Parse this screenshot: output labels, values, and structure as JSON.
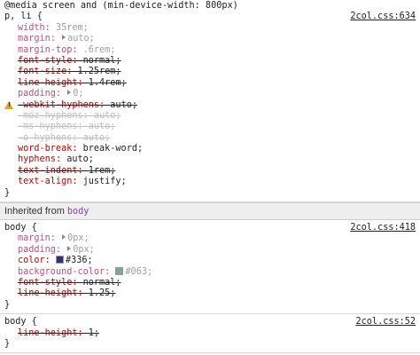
{
  "rules": [
    {
      "lines": [
        {
          "kind": "text",
          "text": "@media screen and (min-device-width: 800px)"
        },
        {
          "kind": "selector",
          "text": "p, li {",
          "source": "2col.css:634"
        }
      ],
      "decls": [
        {
          "prop": "width",
          "value": "35rem;",
          "style": "prop-b"
        },
        {
          "prop": "margin",
          "value": "auto;",
          "style": "prop-b",
          "arrow": true
        },
        {
          "prop": "margin-top",
          "value": ".6rem;",
          "style": "prop-b"
        },
        {
          "prop": "font-style",
          "value": "normal;",
          "style": "struck-dark"
        },
        {
          "prop": "font-size",
          "value": "1.25rem;",
          "style": "struck-dark"
        },
        {
          "prop": "line-height",
          "value": "1.4rem;",
          "style": "struck-dark"
        },
        {
          "prop": "padding",
          "value": "0;",
          "style": "prop-b",
          "arrow": true
        },
        {
          "prop": "-webkit-hyphens",
          "value": "auto;",
          "style": "struck-dark",
          "warn": true
        },
        {
          "prop": "-moz-hyphens",
          "value": "auto;",
          "style": "struck-light"
        },
        {
          "prop": "-ms-hyphens",
          "value": "auto;",
          "style": "struck-light"
        },
        {
          "prop": "-o-hyphens",
          "value": "auto;",
          "style": "struck-light"
        },
        {
          "prop": "word-break",
          "value": "break-word;",
          "style": "prop-a"
        },
        {
          "prop": "hyphens",
          "value": "auto;",
          "style": "prop-a"
        },
        {
          "prop": "text-indent",
          "value": "1rem;",
          "style": "struck-dark"
        },
        {
          "prop": "text-align",
          "value": "justify;",
          "style": "prop-a"
        }
      ],
      "close": "}"
    }
  ],
  "inherited": {
    "label": "Inherited from",
    "tag": "body"
  },
  "body_rule_1": {
    "selector": "body {",
    "source": "2col.css:418",
    "decls": [
      {
        "prop": "margin",
        "value": "0px;",
        "arrow": true
      },
      {
        "prop": "padding",
        "value": "0px;",
        "arrow": true
      },
      {
        "prop": "color",
        "value": "#336;",
        "swatch": "#333366",
        "style": "prop-a"
      },
      {
        "prop": "background-color",
        "value": "#063;",
        "swatch": "#7aa993"
      },
      {
        "prop": "font-style",
        "value": "normal;",
        "style": "struck-dark"
      },
      {
        "prop": "line-height",
        "value": "1.25;",
        "style": "struck-dark"
      }
    ],
    "close": "}"
  },
  "body_rule_2": {
    "selector": "body {",
    "source": "2col.css:52",
    "decls": [
      {
        "prop": "line-height",
        "value": "1;",
        "style": "struck-dark"
      }
    ],
    "close": "}"
  },
  "colors": {
    "swatch_color": "#333366",
    "swatch_bg": "#7aa993",
    "warn": "#e7a800",
    "selector_tag": "#8a3fa3"
  }
}
